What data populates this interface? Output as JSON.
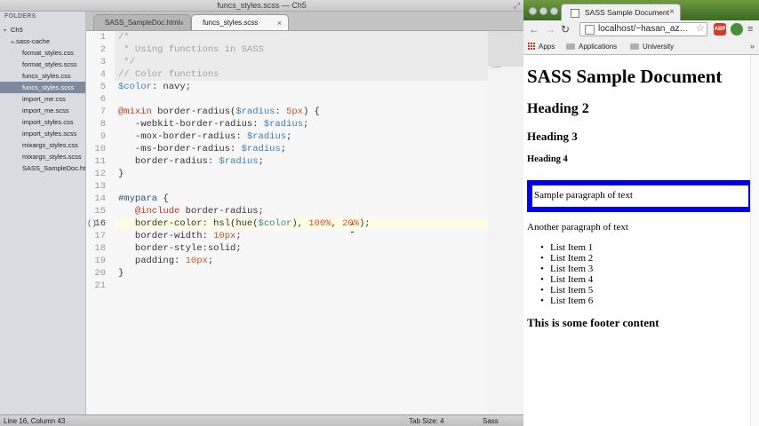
{
  "editor": {
    "title": "funcs_styles.scss — Ch5",
    "sidebar": {
      "header": "FOLDERS",
      "items": [
        {
          "label": "Ch5",
          "expanded": true
        },
        {
          "label": ".sass-cache",
          "collapsed": true
        },
        {
          "label": "format_styles.css"
        },
        {
          "label": "format_styles.scss"
        },
        {
          "label": "funcs_styles.css"
        },
        {
          "label": "funcs_styles.scss",
          "selected": true
        },
        {
          "label": "import_me.css"
        },
        {
          "label": "import_me.scss"
        },
        {
          "label": "import_styles.css"
        },
        {
          "label": "import_styles.scss"
        },
        {
          "label": "mixargs_styles.css"
        },
        {
          "label": "mixargs_styles.scss"
        },
        {
          "label": "SASS_SampleDoc.html"
        }
      ]
    },
    "tabs": [
      {
        "label": "SASS_SampleDoc.html",
        "close": "×",
        "active": false
      },
      {
        "label": "funcs_styles.scss",
        "close": "×",
        "active": true
      }
    ],
    "current_line": 16,
    "lines": [
      {
        "n": "1",
        "text": "/*"
      },
      {
        "n": "2",
        "text": " * Using functions in SASS"
      },
      {
        "n": "3",
        "text": " */"
      },
      {
        "n": "4",
        "text": "// Color functions"
      },
      {
        "n": "5",
        "text": "$color: navy;"
      },
      {
        "n": "6",
        "text": ""
      },
      {
        "n": "7",
        "text": "@mixin border-radius($radius: 5px) {"
      },
      {
        "n": "8",
        "text": "   -webkit-border-radius: $radius;"
      },
      {
        "n": "9",
        "text": "   -mox-border-radius: $radius;"
      },
      {
        "n": "10",
        "text": "   -ms-border-radius: $radius;"
      },
      {
        "n": "11",
        "text": "   border-radius: $radius;"
      },
      {
        "n": "12",
        "text": "}"
      },
      {
        "n": "13",
        "text": ""
      },
      {
        "n": "14",
        "text": "#mypara {"
      },
      {
        "n": "15",
        "text": "   @include border-radius;"
      },
      {
        "n": "16",
        "text": "   border-color: hsl(hue($color), 100%, 20%);"
      },
      {
        "n": "17",
        "text": "   border-width: 10px;"
      },
      {
        "n": "18",
        "text": "   border-style:solid;"
      },
      {
        "n": "19",
        "text": "   padding: 10px;"
      },
      {
        "n": "20",
        "text": "}"
      },
      {
        "n": "21",
        "text": ""
      }
    ],
    "bracket_marker": "()",
    "status": {
      "position": "Line 16, Column 43",
      "tab_size": "Tab Size: 4",
      "syntax": "Sass"
    },
    "syntax_colors": {
      "comment": "#a0a0a0",
      "variable": "#3b7fb5",
      "keyword": "#c0392b",
      "number": "#c0592b"
    }
  },
  "browser": {
    "tab_title": "SASS Sample Document",
    "tab_close": "×",
    "address": "localhost/~hasan_az…",
    "bookmarks": [
      {
        "label": "Apps",
        "icon": "apps-grid-icon"
      },
      {
        "label": "Applications",
        "icon": "folder-icon"
      },
      {
        "label": "University",
        "icon": "folder-icon"
      }
    ],
    "bookmarks_more": "»",
    "extension_label": "ABP",
    "page": {
      "h1": "SASS Sample Document",
      "h2": "Heading 2",
      "h3": "Heading 3",
      "h4": "Heading 4",
      "boxed_paragraph": "Sample paragraph of text",
      "paragraph": "Another paragraph of text",
      "list": [
        "List Item 1",
        "List Item 2",
        "List Item 3",
        "List Item 4",
        "List Item 5",
        "List Item 6"
      ],
      "footer": "This is some footer content",
      "box_border_color": "#0000ee"
    }
  }
}
